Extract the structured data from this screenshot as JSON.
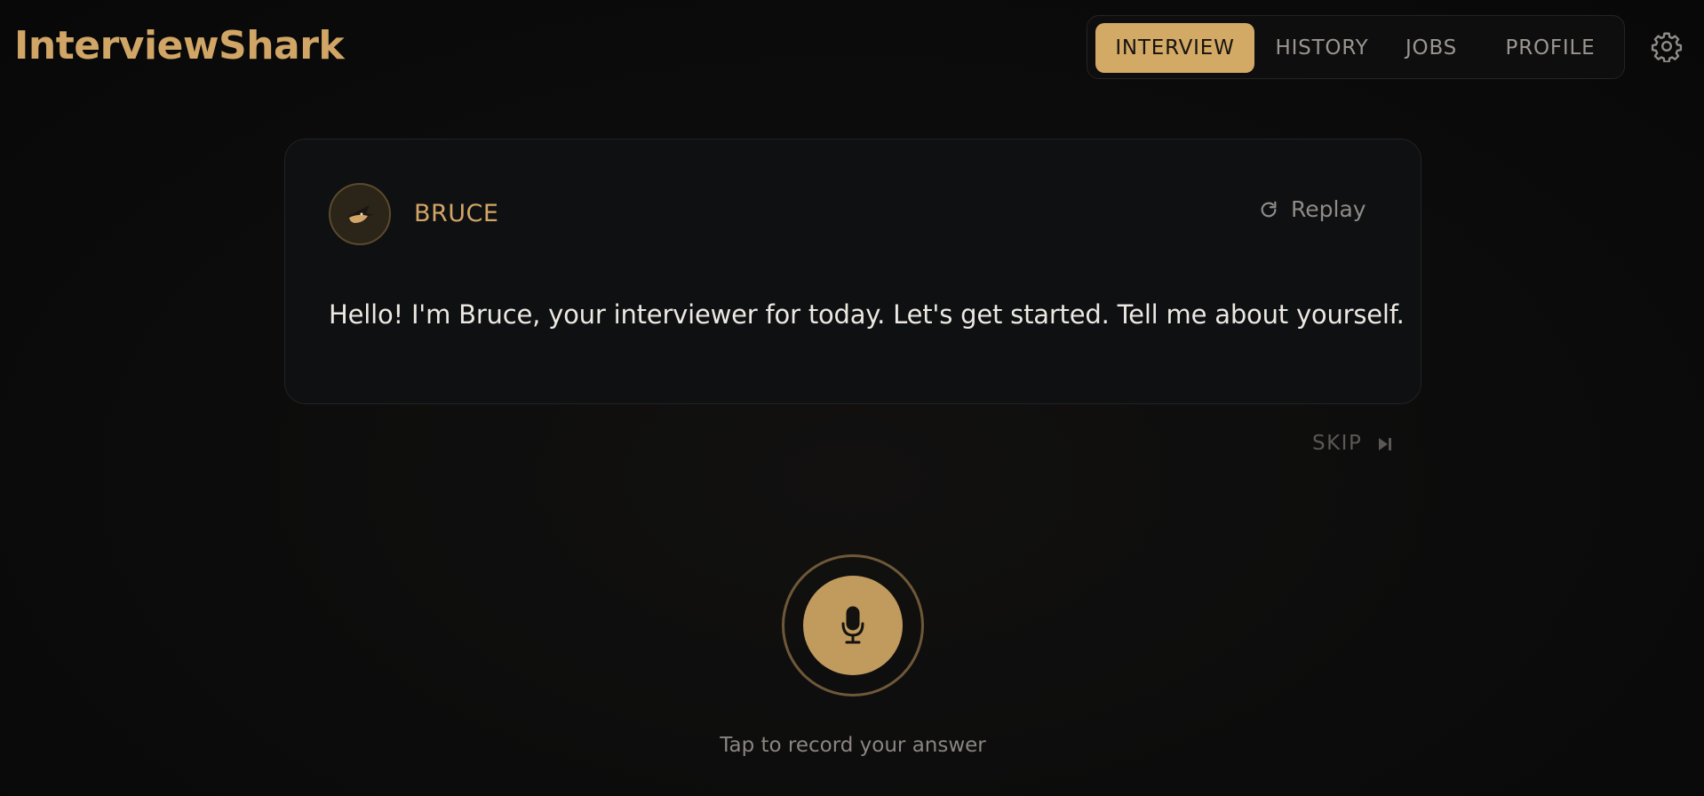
{
  "app": {
    "title": "InterviewShark"
  },
  "nav": {
    "tabs": [
      {
        "label": "INTERVIEW",
        "active": true
      },
      {
        "label": "HISTORY",
        "active": false
      },
      {
        "label": "JOBS",
        "active": false
      },
      {
        "label": "PROFILE",
        "active": false
      }
    ],
    "settings_icon": "gear-icon"
  },
  "card": {
    "speaker_name": "BRUCE",
    "avatar_icon": "shark-avatar",
    "replay_label": "Replay",
    "replay_icon": "refresh-icon",
    "message": "Hello! I'm Bruce, your interviewer for today. Let's get started. Tell me about yourself."
  },
  "skip": {
    "label": "SKIP",
    "icon": "skip-forward-icon"
  },
  "record": {
    "icon": "microphone-icon",
    "hint": "Tap to record your answer"
  },
  "colors": {
    "accent": "#d2a965",
    "background": "#0b0b0c",
    "card_bg": "#0f1012",
    "text": "#ece8e2",
    "muted": "#8f8b86"
  }
}
